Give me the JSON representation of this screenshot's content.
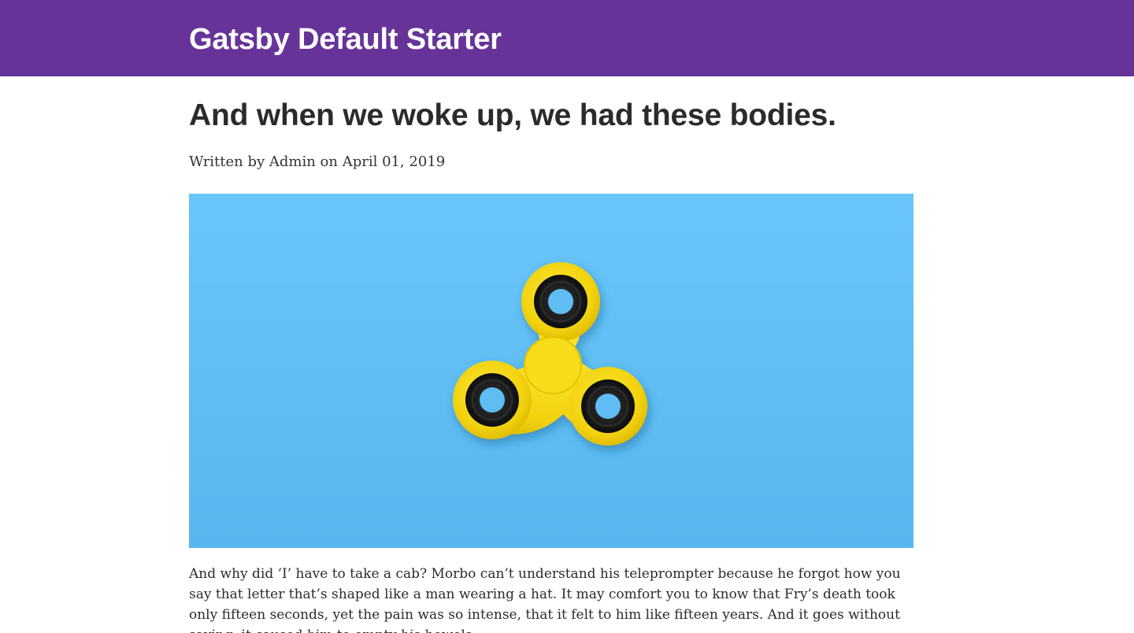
{
  "header": {
    "site_title": "Gatsby Default Starter",
    "background_color": "#663399"
  },
  "post": {
    "title": "And when we woke up, we had these bodies.",
    "byline": "Written by Admin on April 01, 2019",
    "hero_image": {
      "subject": "yellow fidget spinner on blue background",
      "background_color": "#64c1f7",
      "spinner_color": "#f4d90f"
    },
    "body": "And why did ‘I’ have to take a cab? Morbo can’t understand his teleprompter because he forgot how you say that letter that’s shaped like a man wearing a hat. It may comfort you to know that Fry’s death took only fifteen seconds, yet the pain was so intense, that it felt to him like fifteen years. And it goes without saying, it caused him to empty his bowels."
  }
}
